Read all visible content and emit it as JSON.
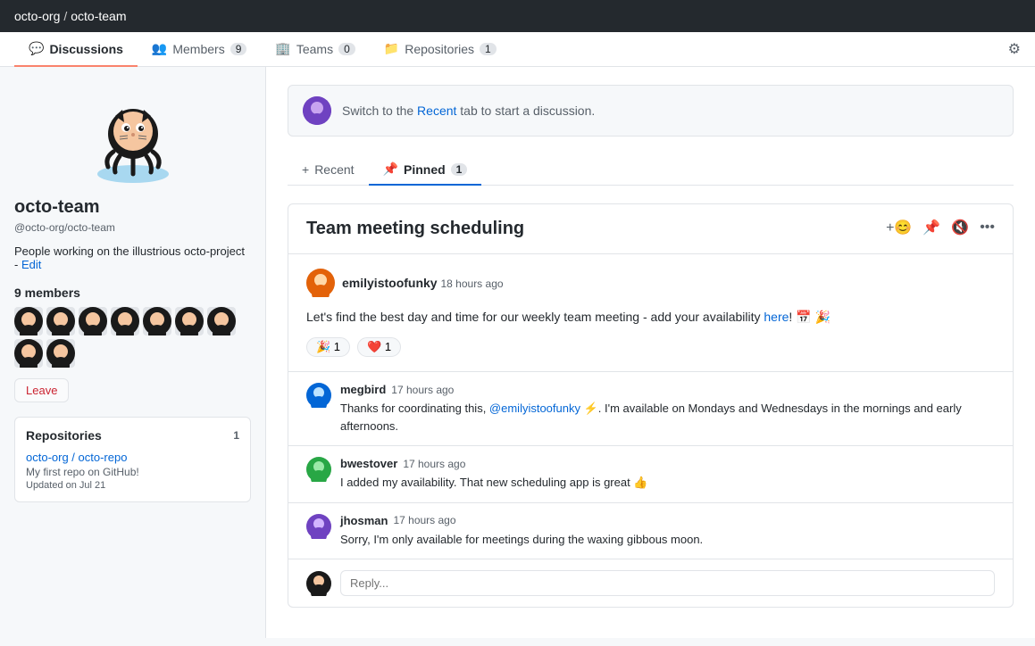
{
  "header": {
    "org": "octo-org",
    "team": "octo-team",
    "breadcrumb_sep": "/"
  },
  "nav": {
    "tabs": [
      {
        "id": "discussions",
        "label": "Discussions",
        "icon": "💬",
        "count": null,
        "active": true
      },
      {
        "id": "members",
        "label": "Members",
        "icon": "👥",
        "count": 9,
        "active": false
      },
      {
        "id": "teams",
        "label": "Teams",
        "icon": "🏢",
        "count": 0,
        "active": false
      },
      {
        "id": "repositories",
        "label": "Repositories",
        "icon": "📁",
        "count": 1,
        "active": false
      }
    ],
    "settings_title": "Settings"
  },
  "sidebar": {
    "team_name": "octo-team",
    "team_handle": "@octo-org/octo-team",
    "description": "People working on the illustrious octo-project",
    "edit_label": "Edit",
    "members_title": "9 members",
    "leave_button": "Leave",
    "repos_section": {
      "title": "Repositories",
      "count": 1,
      "repo_link": "octo-org / octo-repo",
      "repo_desc": "My first repo on GitHub!",
      "repo_updated": "Updated on Jul 21"
    }
  },
  "banner": {
    "text_before": "Switch to the ",
    "link_text": "Recent",
    "text_after": " tab to start a discussion."
  },
  "sub_tabs": [
    {
      "id": "recent",
      "label": "Recent",
      "icon": "+",
      "active": false
    },
    {
      "id": "pinned",
      "label": "Pinned",
      "icon": "📌",
      "count": 1,
      "active": true
    }
  ],
  "discussion": {
    "title": "Team meeting scheduling",
    "author": "emilyistoofunky",
    "time": "18 hours ago",
    "content": "Let's find the best day and time for our weekly team meeting - add your availability here! 📅 🎉",
    "content_link": "here",
    "reactions": [
      {
        "emoji": "🎉",
        "count": 1
      },
      {
        "emoji": "❤️",
        "count": 1
      }
    ],
    "comments": [
      {
        "id": "c1",
        "author": "megbird",
        "time": "17 hours ago",
        "text": "Thanks for coordinating this, @emilyistoofunky ⚡. I'm available on Mondays and Wednesdays in the mornings and early afternoons."
      },
      {
        "id": "c2",
        "author": "bwestover",
        "time": "17 hours ago",
        "text": "I added my availability. That new scheduling app is great 👍"
      },
      {
        "id": "c3",
        "author": "jhosman",
        "time": "17 hours ago",
        "text": "Sorry, I'm only available for meetings during the waxing gibbous moon."
      }
    ],
    "reply_placeholder": "Reply..."
  }
}
